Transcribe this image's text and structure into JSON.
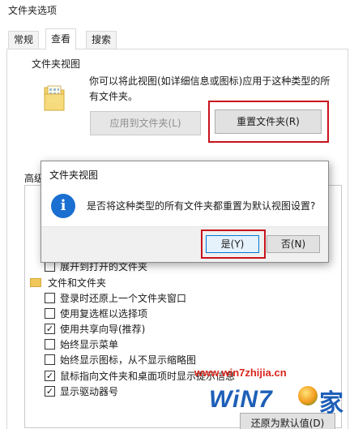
{
  "window": {
    "title": "文件夹选项"
  },
  "tabs": [
    {
      "label": "常规",
      "active": false
    },
    {
      "label": "查看",
      "active": true
    },
    {
      "label": "搜索",
      "active": false
    }
  ],
  "folder_views": {
    "group_label": "文件夹视图",
    "description": "你可以将此视图(如详细信息或图标)应用于这种类型的所有文件夹。",
    "apply_button": "应用到文件夹(L)",
    "reset_button": "重置文件夹(R)"
  },
  "advanced": {
    "label": "高级",
    "items": [
      {
        "type": "checkbox",
        "checked": false,
        "label": "展开到打开的文件夹"
      },
      {
        "type": "folder",
        "label": "文件和文件夹"
      },
      {
        "type": "checkbox",
        "checked": false,
        "label": "登录时还原上一个文件夹窗口"
      },
      {
        "type": "checkbox",
        "checked": false,
        "label": "使用复选框以选择项"
      },
      {
        "type": "checkbox",
        "checked": true,
        "label": "使用共享向导(推荐)"
      },
      {
        "type": "checkbox",
        "checked": false,
        "label": "始终显示菜单"
      },
      {
        "type": "checkbox",
        "checked": false,
        "label": "始终显示图标，从不显示缩略图"
      },
      {
        "type": "checkbox",
        "checked": true,
        "label": "鼠标指向文件夹和桌面项时显示提示信息"
      },
      {
        "type": "checkbox",
        "checked": true,
        "label": "显示驱动器号"
      }
    ],
    "restore_button": "还原为默认值(D)"
  },
  "dialog": {
    "title": "文件夹视图",
    "icon": "info-icon",
    "message": "是否将这种类型的所有文件夹都重置为默认视图设置?",
    "yes_button": "是(Y)",
    "no_button": "否(N)"
  },
  "watermark": {
    "url": "www.win7zhijia.cn",
    "logo_text": "WiN7",
    "logo_char": "家"
  },
  "colors": {
    "highlight_box": "#c8121b",
    "info_icon": "#1a6fd1",
    "primary_button_border": "#0078d7",
    "watermark_red": "#d9261c",
    "watermark_blue": "#1e5fb8"
  }
}
